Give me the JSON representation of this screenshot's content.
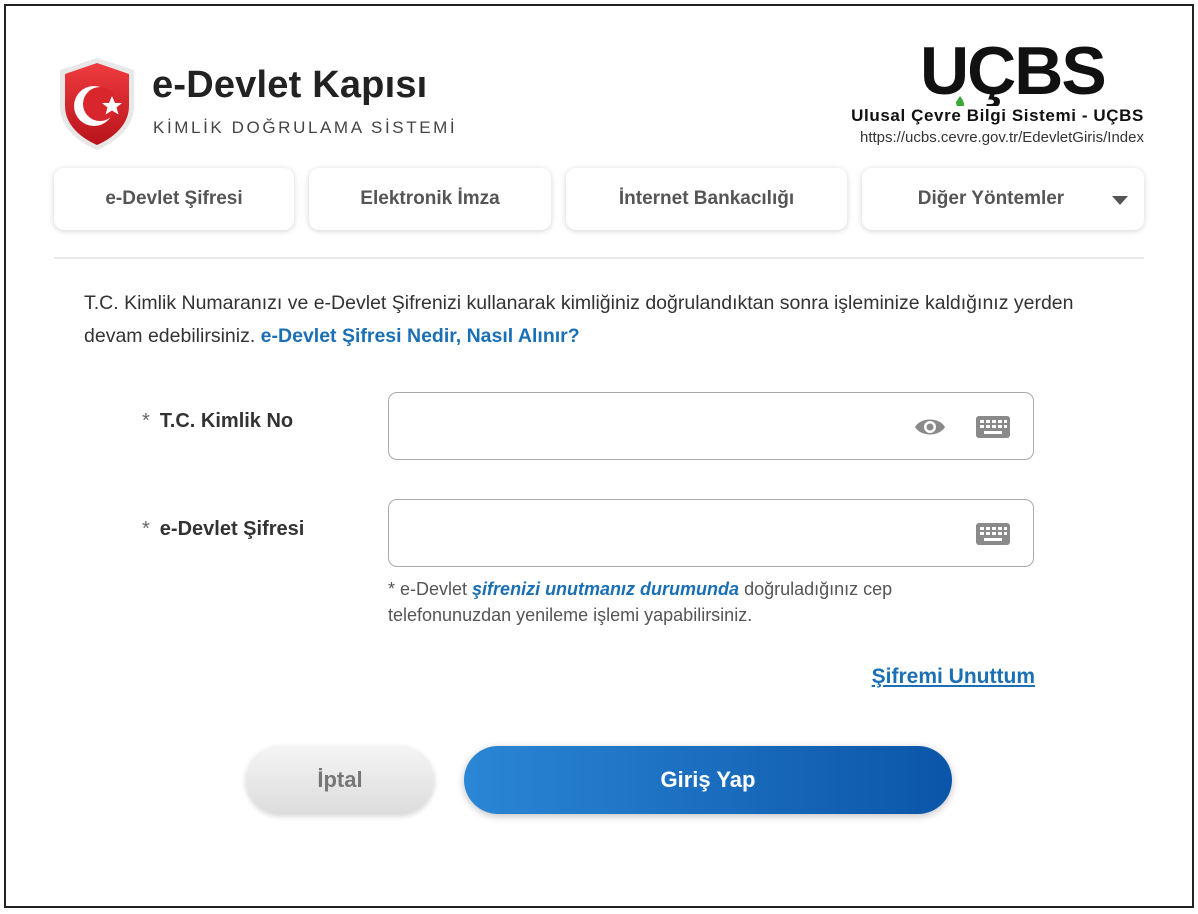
{
  "header": {
    "brand_title": "e-Devlet Kapısı",
    "brand_subtitle": "KİMLİK DOĞRULAMA SİSTEMİ",
    "logo_text": "UÇBS",
    "service_name": "Ulusal Çevre Bilgi Sistemi - UÇBS",
    "service_url": "https://ucbs.cevre.gov.tr/EdevletGiris/Index"
  },
  "tabs": [
    {
      "label": "e-Devlet Şifresi"
    },
    {
      "label": "Elektronik İmza"
    },
    {
      "label": "İnternet Bankacılığı"
    },
    {
      "label": "Diğer Yöntemler"
    }
  ],
  "intro": {
    "text": "T.C. Kimlik Numaranızı ve e-Devlet Şifrenizi kullanarak kimliğiniz doğrulandıktan sonra işleminize kaldığınız yerden devam edebilirsiniz.",
    "link": "e-Devlet Şifresi Nedir, Nasıl Alınır?"
  },
  "form": {
    "required_mark": "*",
    "tckn_label": "T.C. Kimlik No",
    "tckn_value": "",
    "password_label": "e-Devlet Şifresi",
    "password_value": "",
    "hint_prefix": "* e-Devlet",
    "hint_link": "şifrenizi unutmanız durumunda",
    "hint_suffix": "doğruladığınız cep telefonunuzdan yenileme işlemi yapabilirsiniz.",
    "forgot_link": "Şifremi Unuttum"
  },
  "buttons": {
    "cancel": "İptal",
    "login": "Giriş Yap"
  },
  "icons": {
    "eye": "eye-icon",
    "keyboard": "keyboard-icon",
    "shield": "shield-logo-icon",
    "caret": "chevron-down-icon"
  },
  "colors": {
    "accent": "#1a6fb5",
    "login_start": "#2b86d6",
    "login_end": "#0b55a8",
    "brand_red": "#d9262c",
    "ucbs_green": "#3aa935"
  }
}
